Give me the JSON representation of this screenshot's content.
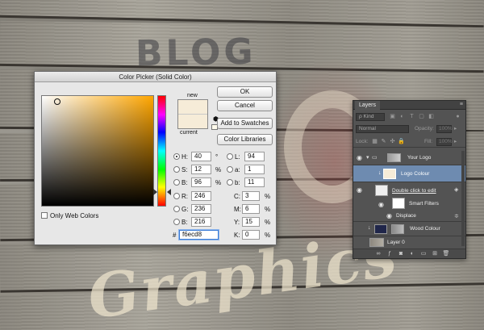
{
  "background": {
    "blog_text": "BLOG",
    "graphics_text": "Graphics"
  },
  "color_picker": {
    "title": "Color Picker (Solid Color)",
    "new_label": "new",
    "current_label": "current",
    "buttons": {
      "ok": "OK",
      "cancel": "Cancel",
      "add_to_swatches": "Add to Swatches",
      "color_libraries": "Color Libraries"
    },
    "only_web_colors": "Only Web Colors",
    "hsb": [
      {
        "label": "H:",
        "value": "40",
        "unit": "°",
        "selected": true
      },
      {
        "label": "S:",
        "value": "12",
        "unit": "%",
        "selected": false
      },
      {
        "label": "B:",
        "value": "96",
        "unit": "%",
        "selected": false
      }
    ],
    "rgb": [
      {
        "label": "R:",
        "value": "246"
      },
      {
        "label": "G:",
        "value": "236"
      },
      {
        "label": "B:",
        "value": "216"
      }
    ],
    "lab": [
      {
        "label": "L:",
        "value": "94"
      },
      {
        "label": "a:",
        "value": "1"
      },
      {
        "label": "b:",
        "value": "11"
      }
    ],
    "cmyk": [
      {
        "label": "C:",
        "value": "3",
        "unit": "%"
      },
      {
        "label": "M:",
        "value": "6",
        "unit": "%"
      },
      {
        "label": "Y:",
        "value": "15",
        "unit": "%"
      },
      {
        "label": "K:",
        "value": "0",
        "unit": "%"
      }
    ],
    "hex_label": "#",
    "hex_value": "f6ecd8",
    "new_color": "#f6ecd8",
    "current_color": "#f6ecd8"
  },
  "layers": {
    "tab_label": "Layers",
    "kind_label": "ρ Kind",
    "blend_mode": "Normal",
    "opacity_label": "Opacity:",
    "opacity_value": "100%",
    "lock_label": "Lock:",
    "fill_label": "Fill:",
    "fill_value": "100%",
    "items": [
      {
        "name": "Your Logo"
      },
      {
        "name": "Logo Colour"
      },
      {
        "name": "Double click to edit"
      },
      {
        "name": "Smart Filters"
      },
      {
        "name": "Displace"
      },
      {
        "name": "Wood Colour"
      },
      {
        "name": "Layer 0"
      }
    ]
  }
}
